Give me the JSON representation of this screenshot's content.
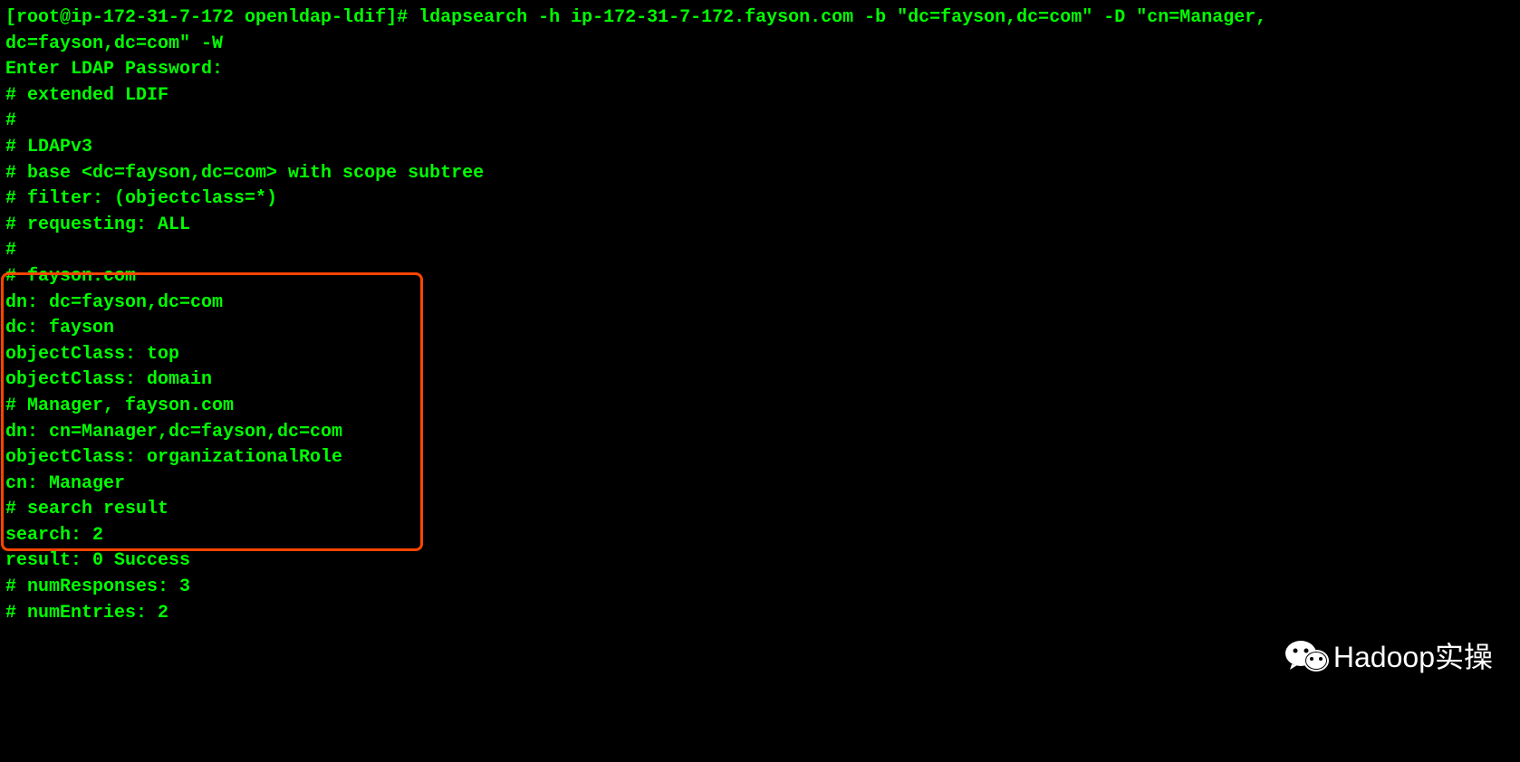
{
  "lines": {
    "l0": "[root@ip-172-31-7-172 openldap-ldif]# ldapsearch -h ip-172-31-7-172.fayson.com -b \"dc=fayson,dc=com\" -D \"cn=Manager,",
    "l1": "dc=fayson,dc=com\" -W",
    "l2": "Enter LDAP Password:",
    "l3": "# extended LDIF",
    "l4": "#",
    "l5": "# LDAPv3",
    "l6": "# base <dc=fayson,dc=com> with scope subtree",
    "l7": "# filter: (objectclass=*)",
    "l8": "# requesting: ALL",
    "l9": "#",
    "l10": "",
    "l11": "# fayson.com",
    "l12": "dn: dc=fayson,dc=com",
    "l13": "dc: fayson",
    "l14": "objectClass: top",
    "l15": "objectClass: domain",
    "l16": "",
    "l17": "# Manager, fayson.com",
    "l18": "dn: cn=Manager,dc=fayson,dc=com",
    "l19": "objectClass: organizationalRole",
    "l20": "cn: Manager",
    "l21": "",
    "l22": "# search result",
    "l23": "search: 2",
    "l24": "result: 0 Success",
    "l25": "",
    "l26": "# numResponses: 3",
    "l27": "# numEntries: 2"
  },
  "watermark": {
    "text": "Hadoop实操"
  }
}
